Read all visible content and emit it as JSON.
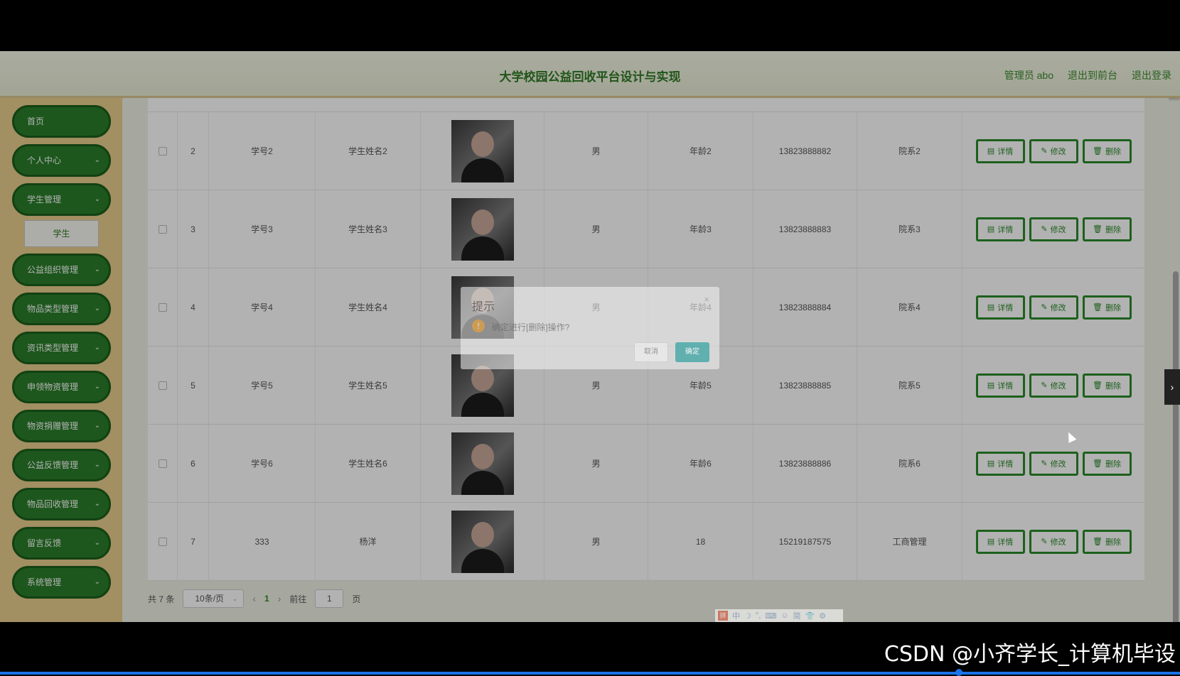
{
  "header": {
    "title": "大学校园公益回收平台设计与实现",
    "links": [
      "管理员 abo",
      "退出到前台",
      "退出登录"
    ]
  },
  "sidebar": {
    "items": [
      {
        "label": "首页",
        "has_chevron": false
      },
      {
        "label": "个人中心",
        "has_chevron": true
      },
      {
        "label": "学生管理",
        "has_chevron": true,
        "sub": [
          "学生"
        ]
      },
      {
        "label": "公益组织管理",
        "has_chevron": true
      },
      {
        "label": "物品类型管理",
        "has_chevron": true
      },
      {
        "label": "资讯类型管理",
        "has_chevron": true
      },
      {
        "label": "申领物资管理",
        "has_chevron": true
      },
      {
        "label": "物资捐赠管理",
        "has_chevron": true
      },
      {
        "label": "公益反馈管理",
        "has_chevron": true
      },
      {
        "label": "物品回收管理",
        "has_chevron": true
      },
      {
        "label": "留言反馈",
        "has_chevron": true
      },
      {
        "label": "系统管理",
        "has_chevron": true
      }
    ],
    "chevron": "⌄"
  },
  "table": {
    "rows": [
      {
        "idx": "2",
        "sno": "学号2",
        "name": "学生姓名2",
        "sex": "男",
        "age": "年龄2",
        "phone": "13823888882",
        "dept": "院系2"
      },
      {
        "idx": "3",
        "sno": "学号3",
        "name": "学生姓名3",
        "sex": "男",
        "age": "年龄3",
        "phone": "13823888883",
        "dept": "院系3"
      },
      {
        "idx": "4",
        "sno": "学号4",
        "name": "学生姓名4",
        "sex": "男",
        "age": "年龄4",
        "phone": "13823888884",
        "dept": "院系4"
      },
      {
        "idx": "5",
        "sno": "学号5",
        "name": "学生姓名5",
        "sex": "男",
        "age": "年龄5",
        "phone": "13823888885",
        "dept": "院系5"
      },
      {
        "idx": "6",
        "sno": "学号6",
        "name": "学生姓名6",
        "sex": "男",
        "age": "年龄6",
        "phone": "13823888886",
        "dept": "院系6"
      },
      {
        "idx": "7",
        "sno": "333",
        "name": "杨洋",
        "sex": "男",
        "age": "18",
        "phone": "15219187575",
        "dept": "工商管理"
      }
    ],
    "actions": {
      "detail": "详情",
      "edit": "修改",
      "delete": "删除"
    },
    "action_icons": {
      "detail": "▤",
      "edit": "✎",
      "delete": "🗑"
    }
  },
  "pager": {
    "total": "共 7 条",
    "page_size": "10条/页",
    "prev": "‹",
    "current": "1",
    "next": "›",
    "goto_prefix": "前往",
    "goto_value": "1",
    "goto_suffix": "页"
  },
  "dialog": {
    "title": "提示",
    "close": "×",
    "warn_icon": "!",
    "message": "确定进行[删除]操作?",
    "cancel": "取消",
    "confirm": "确定"
  },
  "side_tab_icon": "›",
  "ime": {
    "logo": "拼",
    "items": [
      "中",
      "☽",
      "°,",
      "⌨",
      "☺",
      "简",
      "👕",
      "⚙"
    ]
  },
  "watermark": "CSDN @小齐学长_计算机毕设",
  "colors": {
    "primary_green": "#2a8a2a",
    "sidebar_bg": "#e9cd8d",
    "title_green": "#2f7a25"
  }
}
